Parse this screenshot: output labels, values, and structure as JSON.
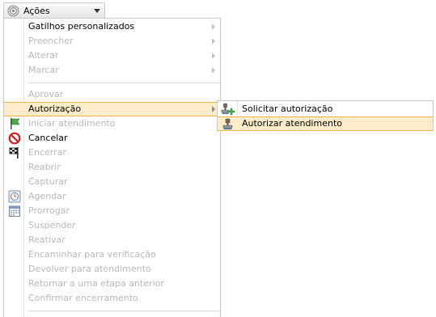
{
  "button": {
    "label": "Ações",
    "icon": "gear-icon"
  },
  "menu": {
    "items": [
      {
        "label": "Gatilhos personalizados",
        "enabled": true,
        "submenu": true
      },
      {
        "label": "Preencher",
        "enabled": false,
        "submenu": true
      },
      {
        "label": "Alterar",
        "enabled": false,
        "submenu": true
      },
      {
        "label": "Marcar",
        "enabled": false,
        "submenu": true
      },
      {
        "label": "Aprovar",
        "enabled": false
      },
      {
        "label": "Autorização",
        "enabled": true,
        "submenu": true,
        "highlighted": true
      },
      {
        "label": "Iniciar atendimento",
        "enabled": false,
        "icon": "green-flag-icon"
      },
      {
        "label": "Cancelar",
        "enabled": true,
        "icon": "prohibited-icon"
      },
      {
        "label": "Encerrar",
        "enabled": false,
        "icon": "checkered-flag-icon"
      },
      {
        "label": "Reabrir",
        "enabled": false
      },
      {
        "label": "Capturar",
        "enabled": false
      },
      {
        "label": "Agendar",
        "enabled": false,
        "icon": "clock-icon"
      },
      {
        "label": "Prorrogar",
        "enabled": false,
        "icon": "calendar-icon"
      },
      {
        "label": "Suspender",
        "enabled": false
      },
      {
        "label": "Reativar",
        "enabled": false
      },
      {
        "label": "Encaminhar para verificação",
        "enabled": false
      },
      {
        "label": "Devolver para atendimento",
        "enabled": false
      },
      {
        "label": "Retornar a uma etapa anterior",
        "enabled": false
      },
      {
        "label": "Confirmar encerramento",
        "enabled": false
      }
    ]
  },
  "submenu": {
    "items": [
      {
        "label": "Solicitar autorização",
        "icon": "stamp-add-icon"
      },
      {
        "label": "Autorizar atendimento",
        "icon": "stamp-icon",
        "highlighted": true
      }
    ]
  },
  "colors": {
    "highlight_bg": "#fcecc9",
    "highlight_border": "#f1b447",
    "disabled_text": "#b9b9b9",
    "menu_border": "#c9c9c9"
  }
}
